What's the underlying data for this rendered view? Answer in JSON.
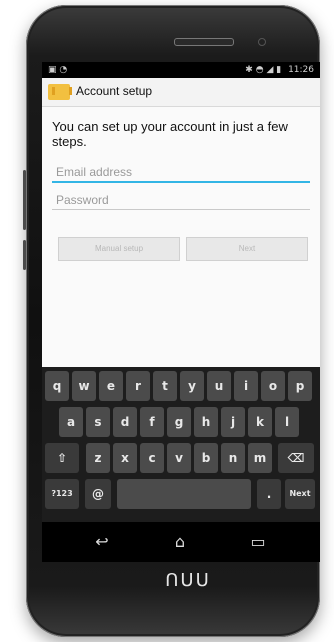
{
  "status_bar": {
    "left_icons": [
      "image-icon",
      "android-icon"
    ],
    "right_icons": [
      "bluetooth-icon",
      "wifi-icon",
      "signal-icon",
      "battery-icon"
    ],
    "time": "11:26"
  },
  "action_bar": {
    "title": "Account setup",
    "icon": "mail-icon"
  },
  "content": {
    "intro": "You can set up your account in just a few steps.",
    "email": {
      "placeholder": "Email address",
      "value": ""
    },
    "password": {
      "placeholder": "Password",
      "value": ""
    },
    "buttons": {
      "manual_setup": "Manual setup",
      "next": "Next"
    }
  },
  "keyboard": {
    "row1": [
      "q",
      "w",
      "e",
      "r",
      "t",
      "y",
      "u",
      "i",
      "o",
      "p"
    ],
    "row2": [
      "a",
      "s",
      "d",
      "f",
      "g",
      "h",
      "j",
      "k",
      "l"
    ],
    "row3": [
      "z",
      "x",
      "c",
      "v",
      "b",
      "n",
      "m"
    ],
    "shift": "⇧",
    "backspace": "⌫",
    "symbols": "?123",
    "at": "@",
    "dot": ".",
    "next": "Next"
  },
  "nav": {
    "back": "↩",
    "home": "⌂",
    "recent": "▭"
  },
  "brand": "ᑎUU"
}
